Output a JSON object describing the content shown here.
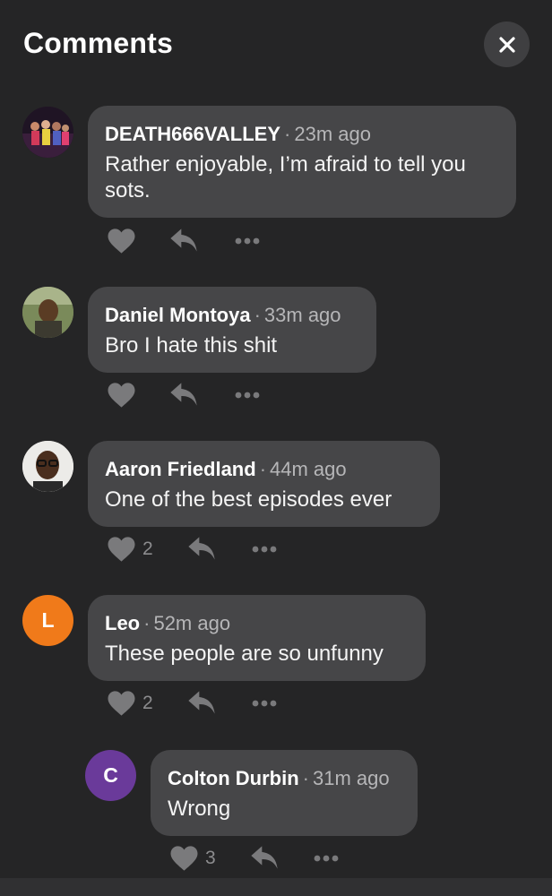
{
  "header": {
    "title": "Comments"
  },
  "icons": {
    "close": "close-icon",
    "like": "heart-icon",
    "reply": "reply-icon",
    "more": "more-icon"
  },
  "colors": {
    "background": "#252526",
    "bubble": "#464648",
    "icon": "#7a7a7c",
    "avatar_leo": "#f07a1a",
    "avatar_colton": "#6a3a9a"
  },
  "comments": [
    {
      "author": "DEATH666VALLEY",
      "time": "23m ago",
      "text": "Rather enjoyable, I’m afraid to tell you sots.",
      "avatar": "photo",
      "likes": null
    },
    {
      "author": "Daniel Montoya",
      "time": "33m ago",
      "text": "Bro I hate this shit",
      "avatar": "photo",
      "likes": null
    },
    {
      "author": "Aaron Friedland",
      "time": "44m ago",
      "text": "One of the best episodes ever",
      "avatar": "photo",
      "likes": "2"
    },
    {
      "author": "Leo",
      "time": "52m ago",
      "text": "These people are so unfunny",
      "avatar": "L",
      "likes": "2"
    },
    {
      "author": "Colton Durbin",
      "time": "31m ago",
      "text": "Wrong",
      "avatar": "C",
      "likes": "3",
      "reply": true
    }
  ]
}
